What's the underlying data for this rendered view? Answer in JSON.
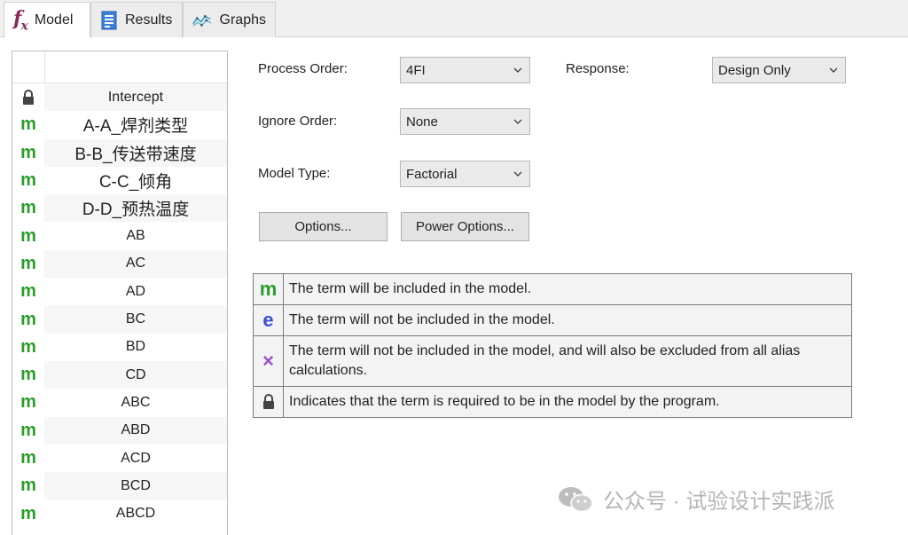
{
  "tabs": [
    {
      "label": "Model",
      "icon": "fx-icon",
      "active": true
    },
    {
      "label": "Results",
      "icon": "results-icon",
      "active": false
    },
    {
      "label": "Graphs",
      "icon": "graphs-icon",
      "active": false
    }
  ],
  "terms": [
    {
      "mark": "lock",
      "label": "Intercept"
    },
    {
      "mark": "m",
      "label": "A-A_焊剂类型"
    },
    {
      "mark": "m",
      "label": "B-B_传送带速度"
    },
    {
      "mark": "m",
      "label": "C-C_倾角"
    },
    {
      "mark": "m",
      "label": "D-D_预热温度"
    },
    {
      "mark": "m",
      "label": "AB"
    },
    {
      "mark": "m",
      "label": "AC"
    },
    {
      "mark": "m",
      "label": "AD"
    },
    {
      "mark": "m",
      "label": "BC"
    },
    {
      "mark": "m",
      "label": "BD"
    },
    {
      "mark": "m",
      "label": "CD"
    },
    {
      "mark": "m",
      "label": "ABC"
    },
    {
      "mark": "m",
      "label": "ABD"
    },
    {
      "mark": "m",
      "label": "ACD"
    },
    {
      "mark": "m",
      "label": "BCD"
    },
    {
      "mark": "m",
      "label": "ABCD"
    }
  ],
  "form": {
    "process_order_label": "Process Order:",
    "process_order_value": "4FI",
    "response_label": "Response:",
    "response_value": "Design Only",
    "ignore_order_label": "Ignore Order:",
    "ignore_order_value": "None",
    "model_type_label": "Model Type:",
    "model_type_value": "Factorial",
    "options_button": "Options...",
    "power_options_button": "Power Options..."
  },
  "legend": [
    {
      "symbol": "m",
      "color": "#2a9d2a",
      "text": "The term will be included in the model."
    },
    {
      "symbol": "e",
      "color": "#3a4fd6",
      "text": "The term will not be included in the model."
    },
    {
      "symbol": "×",
      "color": "#9b4fc4",
      "text": "The term will not be included in the model, and will also be excluded from all alias calculations."
    },
    {
      "symbol": "lock",
      "color": "#444444",
      "text": "Indicates that the term is required to be in the model by the program."
    }
  ],
  "watermark": {
    "text": "公众号 · 试验设计实践派",
    "icon": "wechat-icon"
  },
  "colors": {
    "included": "#2a9d2a",
    "excluded": "#3a4fd6",
    "alias_excluded": "#9b4fc4",
    "fx": "#8a2a5e"
  }
}
